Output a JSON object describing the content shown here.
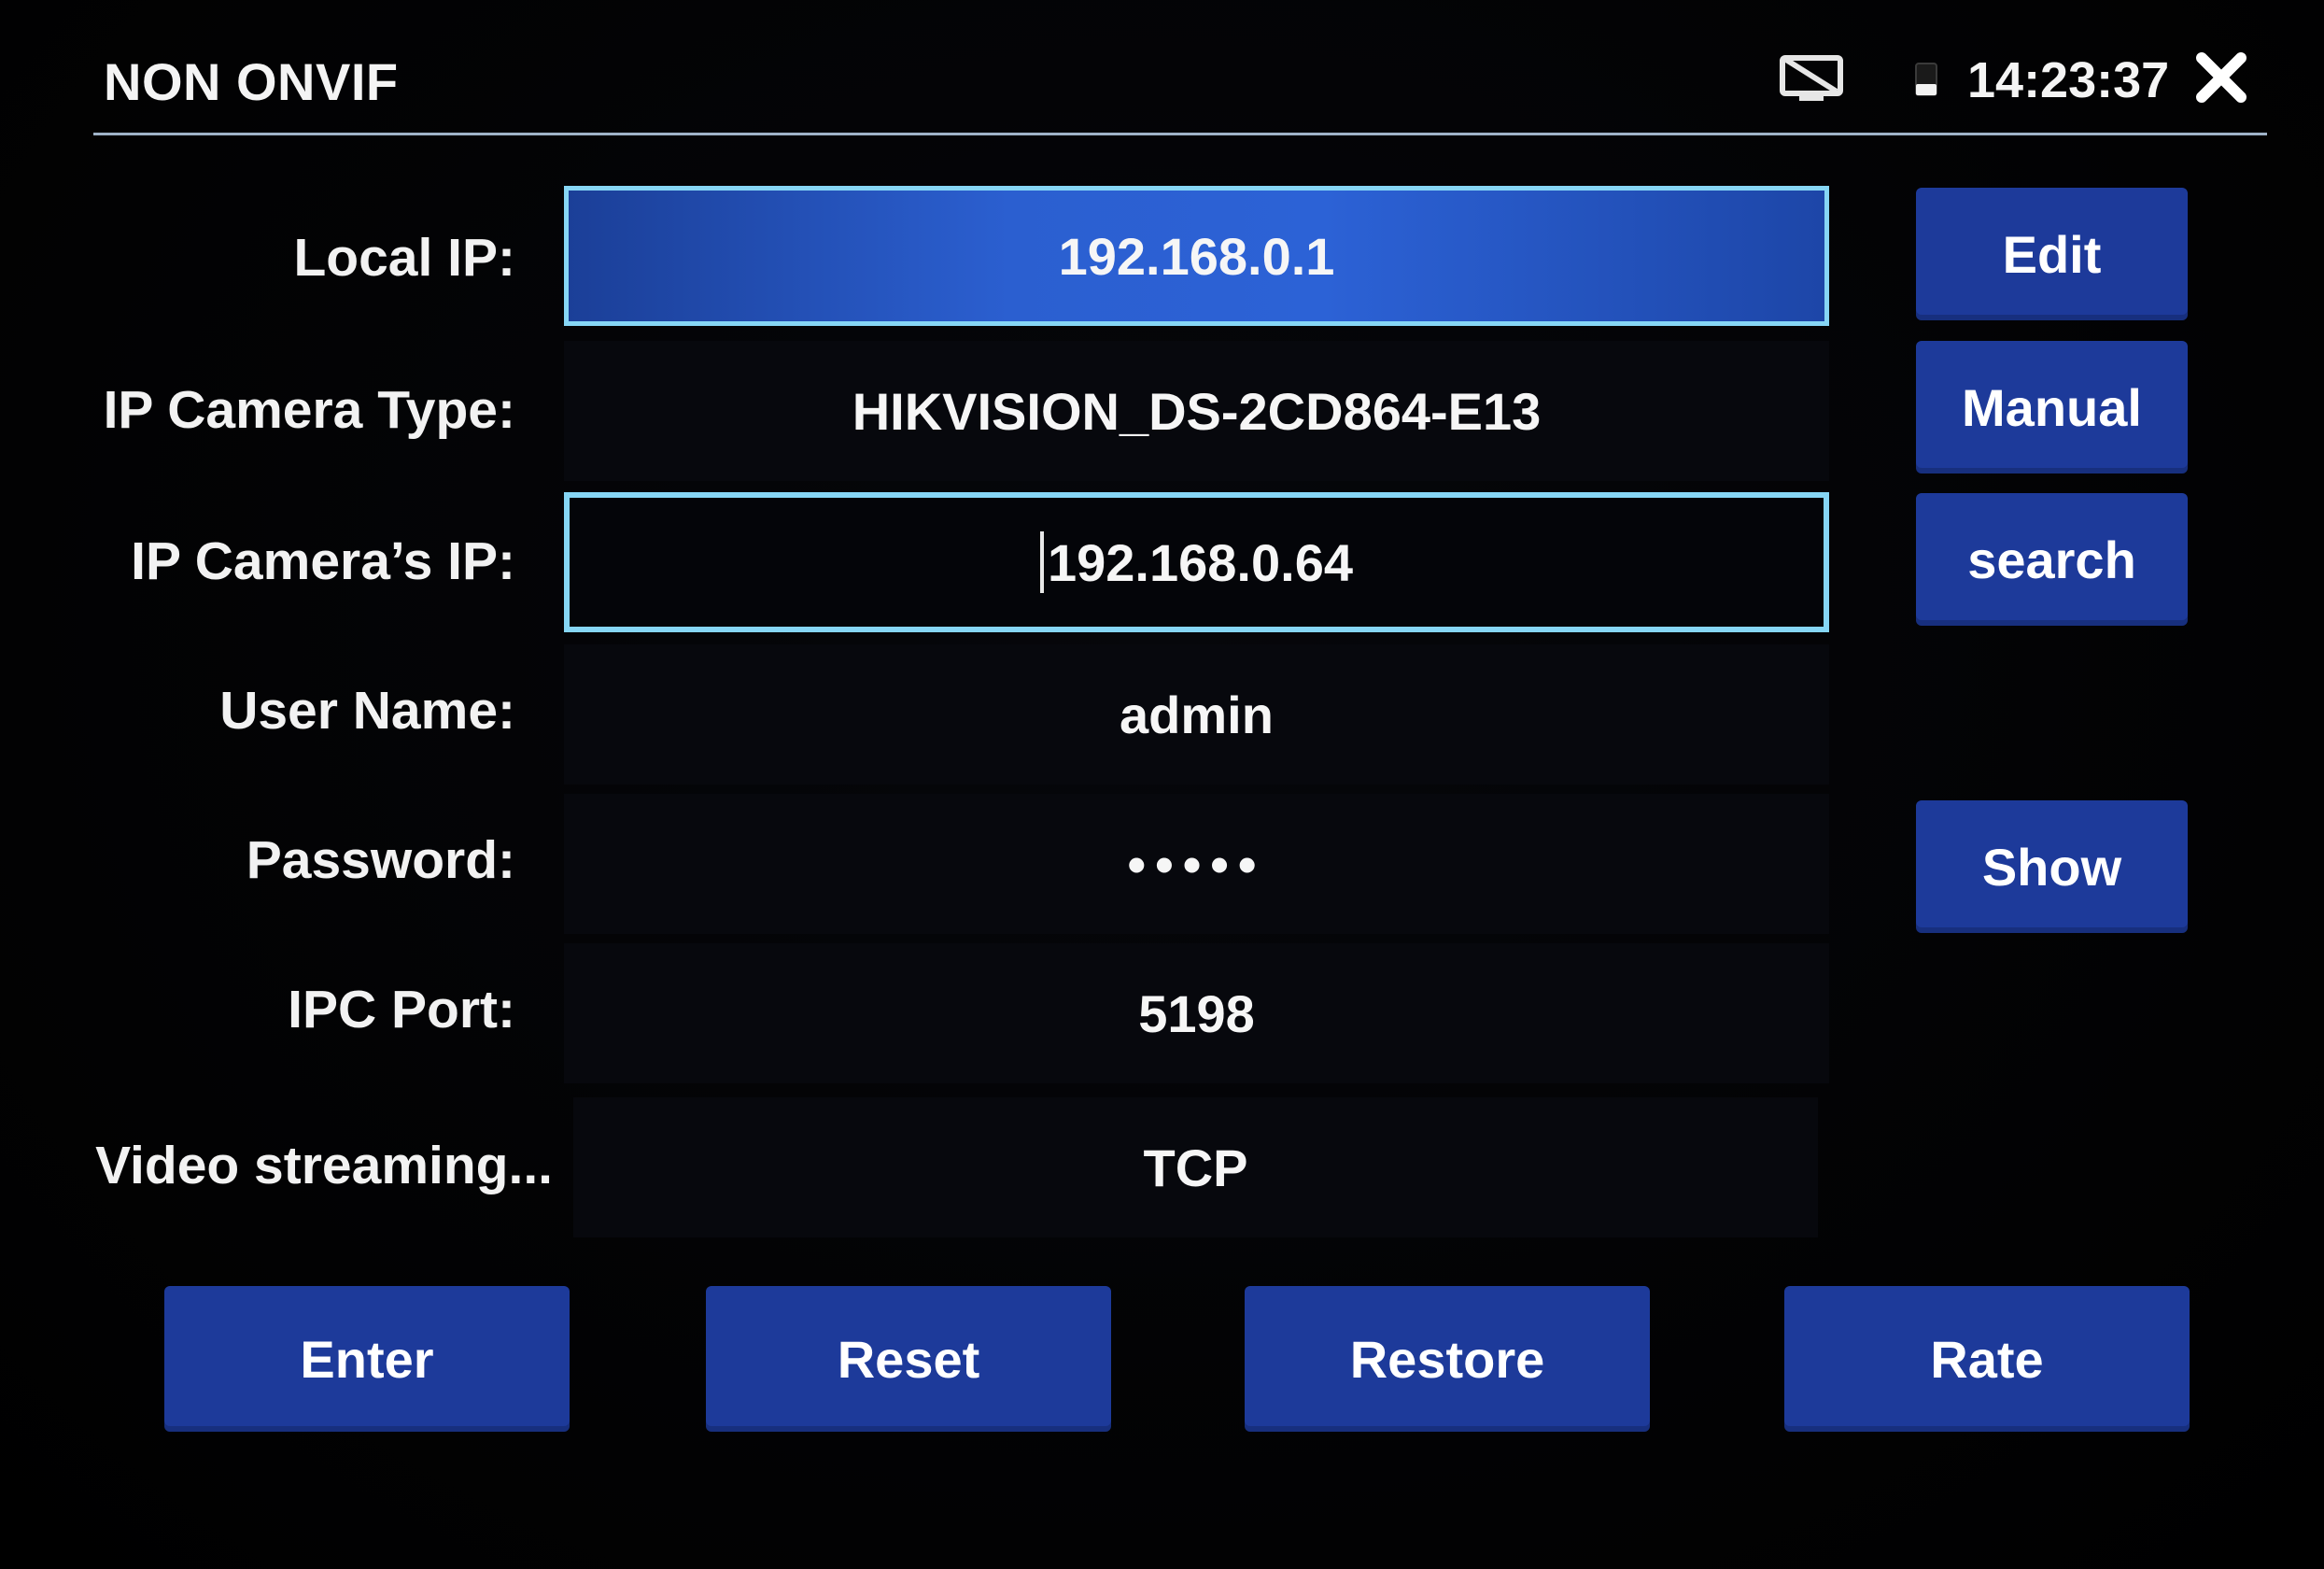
{
  "header": {
    "title": "NON ONVIF",
    "time": "14:23:37",
    "icons": [
      "no-signal-icon",
      "battery-icon",
      "close-icon"
    ]
  },
  "form": {
    "local_ip": {
      "label": "Local IP:",
      "value": "192.168.0.1"
    },
    "camera_type": {
      "label": "IP Camera Type:",
      "value": "HIKVISION_DS-2CD864-E13"
    },
    "camera_ip": {
      "label": "IP Camera’s IP:",
      "value": "192.168.0.64"
    },
    "user_name": {
      "label": "User Name:",
      "value": "admin"
    },
    "password": {
      "label": "Password:",
      "value": "•••••"
    },
    "ipc_port": {
      "label": "IPC Port:",
      "value": "5198"
    },
    "video_streaming": {
      "label": "Video streaming...",
      "value": "TCP"
    }
  },
  "side_buttons": {
    "edit": "Edit",
    "manual": "Manual",
    "search": "search",
    "show": "Show"
  },
  "bottom_buttons": {
    "enter": "Enter",
    "reset": "Reset",
    "restore": "Restore",
    "rate": "Rate"
  },
  "colors": {
    "button": "#1d3a9a",
    "selected_field": "#2c62d6",
    "focus_border": "#86d6f5",
    "background": "#000000"
  }
}
